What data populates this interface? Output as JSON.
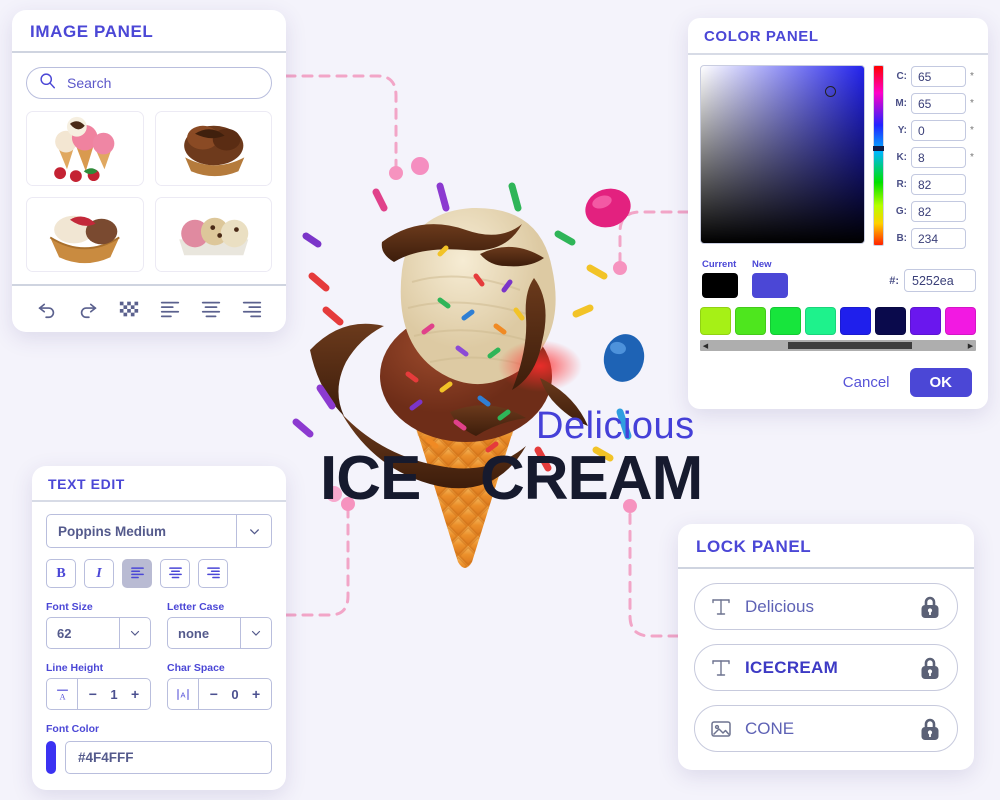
{
  "canvas": {
    "captions": {
      "delicious": "Delicious",
      "ice": "ICE",
      "cream": "CREAM"
    },
    "artwork_name": "ice-cream-cone-illustration"
  },
  "image_panel": {
    "title": "IMAGE PANEL",
    "search": {
      "value": "",
      "placeholder": "Search",
      "icon": "search-icon"
    },
    "thumbnails": [
      {
        "name": "sundae-cones-with-strawberries"
      },
      {
        "name": "chocolate-scoops-in-waffle-bowl"
      },
      {
        "name": "ice-cream-in-waffle-basket"
      },
      {
        "name": "three-scoops-in-tray"
      }
    ],
    "tools": [
      {
        "name": "undo-icon",
        "label": "Undo"
      },
      {
        "name": "redo-icon",
        "label": "Redo"
      },
      {
        "name": "transparency-icon",
        "label": "Transparency"
      },
      {
        "name": "align-left-icon",
        "label": "Align left"
      },
      {
        "name": "align-center-icon",
        "label": "Align center"
      },
      {
        "name": "align-right-icon",
        "label": "Align right"
      }
    ]
  },
  "color_panel": {
    "title": "COLOR PANEL",
    "fields": [
      {
        "label": "C:",
        "value": "65",
        "suffix": "*"
      },
      {
        "label": "M:",
        "value": "65",
        "suffix": "*"
      },
      {
        "label": "Y:",
        "value": "0",
        "suffix": "*"
      },
      {
        "label": "K:",
        "value": "8",
        "suffix": "*"
      },
      {
        "label": "R:",
        "value": "82",
        "suffix": ""
      },
      {
        "label": "G:",
        "value": "82",
        "suffix": ""
      },
      {
        "label": "B:",
        "value": "234",
        "suffix": ""
      }
    ],
    "current_label": "Current",
    "new_label": "New",
    "current_color": "#000000",
    "new_color": "#4b47d6",
    "hex_label": "#:",
    "hex_value": "5252ea",
    "palette": [
      "#a6f016",
      "#4ee61e",
      "#17e53c",
      "#1ef28c",
      "#1f1fec",
      "#0a0a4c",
      "#6a17ee",
      "#f219e2"
    ],
    "cancel_label": "Cancel",
    "ok_label": "OK"
  },
  "text_edit": {
    "title": "TEXT EDIT",
    "font_family": {
      "value": "Poppins Medium",
      "caret": "chevron-down-icon"
    },
    "format_buttons": [
      {
        "name": "bold-button",
        "glyph": "B",
        "active": false
      },
      {
        "name": "italic-button",
        "glyph": "I",
        "active": false
      },
      {
        "name": "align-left-button",
        "glyph": "",
        "active": true
      },
      {
        "name": "align-center-button",
        "glyph": "",
        "active": false
      },
      {
        "name": "align-right-button",
        "glyph": "",
        "active": false
      }
    ],
    "font_size": {
      "label": "Font Size",
      "value": "62"
    },
    "letter_case": {
      "label": "Letter Case",
      "value": "none"
    },
    "line_height": {
      "label": "Line Height",
      "value": "1",
      "minus": "−",
      "plus": "+",
      "icon": "line-height-icon"
    },
    "char_space": {
      "label": "Char Space",
      "value": "0",
      "minus": "−",
      "plus": "+",
      "icon": "char-space-icon"
    },
    "font_color": {
      "label": "Font Color",
      "swatch": "#3b32f2",
      "value": "#4F4FFF"
    }
  },
  "lock_panel": {
    "title": "LOCK PANEL",
    "items": [
      {
        "label": "Delicious",
        "type_icon": "text-layer-icon",
        "lock_icon": "padlock-icon",
        "bold": false
      },
      {
        "label": "ICECREAM",
        "type_icon": "text-layer-icon",
        "lock_icon": "padlock-icon",
        "bold": true
      },
      {
        "label": "CONE",
        "type_icon": "image-layer-icon",
        "lock_icon": "padlock-icon",
        "bold": false
      }
    ]
  },
  "theme": {
    "background": "#f4f3fb",
    "accent": "#4b47d6",
    "connector": "#f3a6c8"
  }
}
